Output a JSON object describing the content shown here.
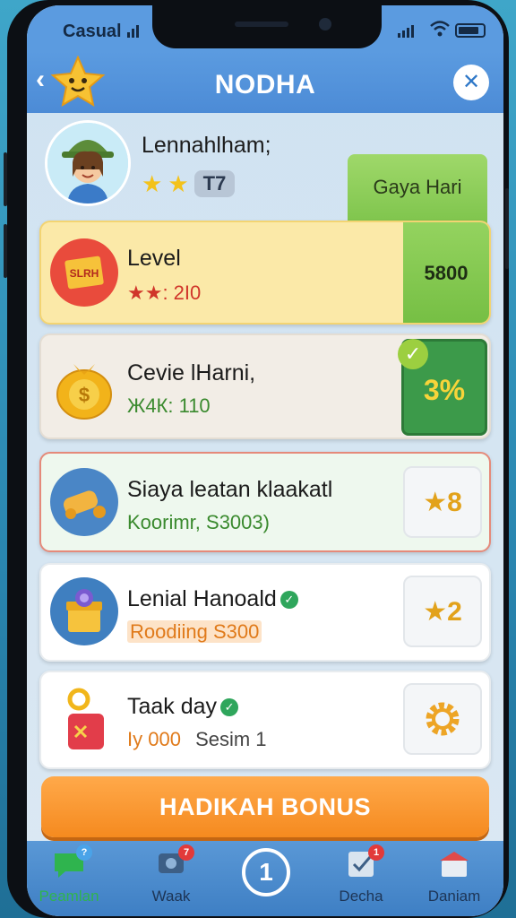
{
  "status_bar": {
    "carrier": "Casual"
  },
  "header": {
    "back_icon": "back-arrow-icon",
    "title": "NODHA",
    "close_icon": "close-x-icon"
  },
  "profile": {
    "username": "Lennahlham;",
    "rank": "T7",
    "stars": 2,
    "daily_label": "Gaya Hari"
  },
  "cards": [
    {
      "title": "Level",
      "subtitle": "★★: 2I0",
      "reward": "5800",
      "icon": "ticket-icon",
      "accent": "#e94b3c"
    },
    {
      "title": "Cevie lHarni,",
      "subtitle": "Ж4К: 110",
      "reward": "3%",
      "icon": "coin-bag-icon",
      "accent": "#f2b31a"
    },
    {
      "title": "Siaya leatan klaakatl",
      "subtitle": "Koorimr, S3003)",
      "reward": "★8",
      "icon": "cannon-icon",
      "accent": "#4a86c6"
    },
    {
      "title": "Lenial Hanoald",
      "subtitle": "Roodiing S300",
      "reward": "★2",
      "icon": "gift-box-icon",
      "accent": "#3f7fc0"
    },
    {
      "title": "Taak day",
      "subtitle_a": "Iy 000",
      "subtitle_b": "Sesim 1",
      "reward_icon": "gear-icon",
      "icon": "gift-bag-icon",
      "accent": "#ffffff"
    }
  ],
  "bonus_button": {
    "label": "HADIKAH BONUS"
  },
  "bottom_nav": [
    {
      "label": "Peamlan",
      "icon": "chat-icon",
      "badge": ""
    },
    {
      "label": "Waak",
      "icon": "message-icon",
      "badge": "7"
    },
    {
      "label": "",
      "icon": "center-one-icon",
      "center": "1"
    },
    {
      "label": "Decha",
      "icon": "checklist-icon",
      "badge": "1"
    },
    {
      "label": "Daniam",
      "icon": "shop-icon",
      "badge": ""
    }
  ]
}
